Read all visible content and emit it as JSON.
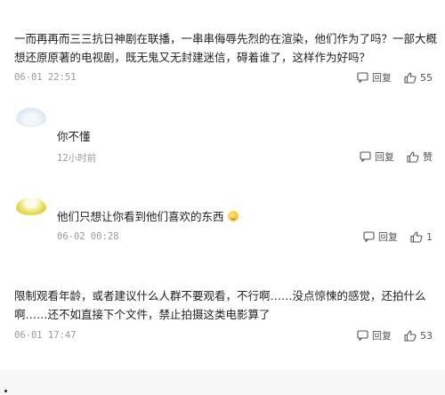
{
  "comments": [
    {
      "lines": [
        "一而再再而三三抗日神剧在联播，一串串侮辱先烈的在渲染，他们作为了吗？一部大概",
        "想还原原著的电视剧，既无鬼又无封建迷信，碍着谁了，这样作为好吗？"
      ],
      "time": "06-01  22:51",
      "reply_label": "回复",
      "like_count": "55"
    },
    {
      "lines": [
        "你不懂"
      ],
      "time": "12小时前",
      "reply_label": "回复",
      "like_count": "赞"
    },
    {
      "lines": [
        "他们只想让你看到他们喜欢的东西"
      ],
      "time": "06-02  00:28",
      "reply_label": "回复",
      "like_count": "1"
    },
    {
      "lines": [
        "限制观看年龄，或者建议什么人群不要观看，不行啊……没点惊悚的感觉，还拍什么",
        "啊……还不如直接下个文件，禁止拍摄这类电影算了"
      ],
      "time": "06-01  17:47",
      "reply_label": "回复",
      "like_count": "53"
    }
  ],
  "icons": {
    "reply": "reply-icon",
    "like": "thumbs-up-icon",
    "emoji": "smile-emoji-icon"
  },
  "colors": {
    "text": "#222222",
    "meta": "#9a9a9a",
    "action": "#555555",
    "avatar_1": "#e3eef7",
    "avatar_2": "#d9cf3a"
  }
}
